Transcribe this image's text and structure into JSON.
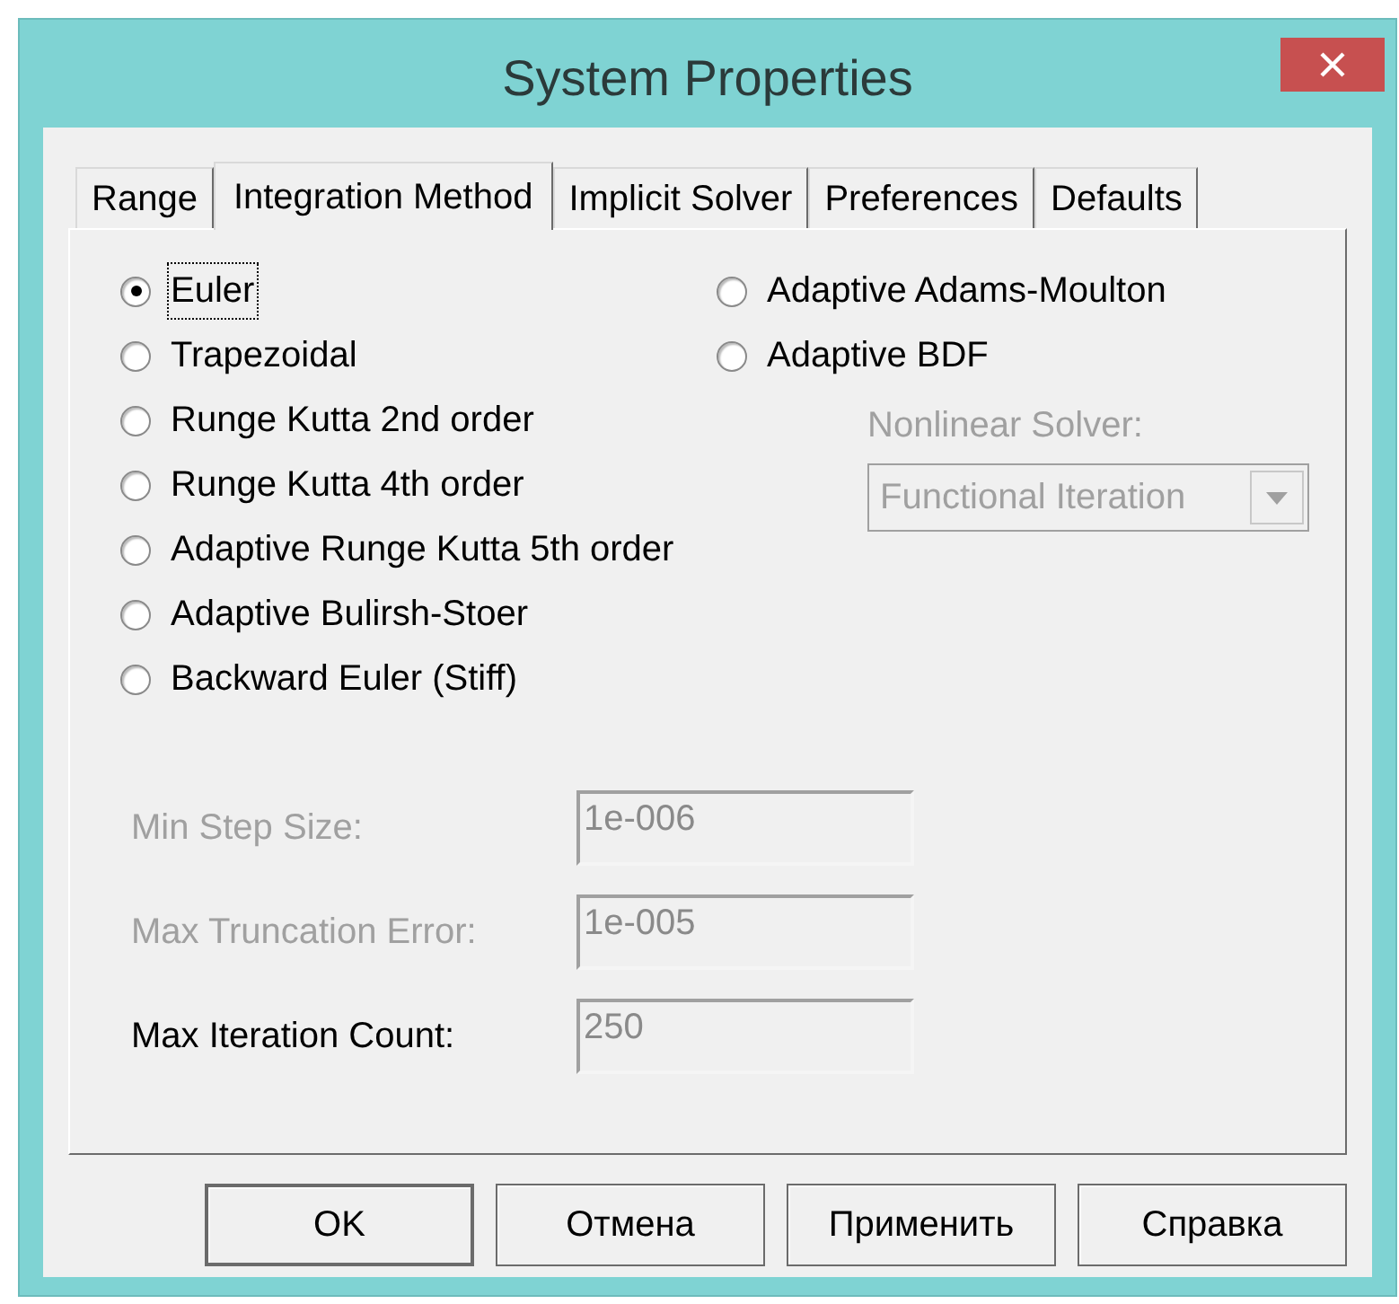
{
  "window": {
    "title": "System Properties"
  },
  "tabs": [
    {
      "label": "Range",
      "selected": false
    },
    {
      "label": "Integration Method",
      "selected": true
    },
    {
      "label": "Implicit Solver",
      "selected": false
    },
    {
      "label": "Preferences",
      "selected": false
    },
    {
      "label": "Defaults",
      "selected": false
    }
  ],
  "methods_left": [
    {
      "label": "Euler",
      "selected": true,
      "focused": true
    },
    {
      "label": "Trapezoidal",
      "selected": false,
      "focused": false
    },
    {
      "label": "Runge Kutta 2nd order",
      "selected": false,
      "focused": false
    },
    {
      "label": "Runge Kutta 4th order",
      "selected": false,
      "focused": false
    },
    {
      "label": "Adaptive Runge Kutta 5th order",
      "selected": false,
      "focused": false
    },
    {
      "label": "Adaptive Bulirsh-Stoer",
      "selected": false,
      "focused": false
    },
    {
      "label": "Backward Euler (Stiff)",
      "selected": false,
      "focused": false
    }
  ],
  "methods_right": [
    {
      "label": "Adaptive Adams-Moulton",
      "selected": false,
      "focused": false
    },
    {
      "label": "Adaptive BDF",
      "selected": false,
      "focused": false
    }
  ],
  "nonlinear_solver": {
    "label": "Nonlinear Solver:",
    "value": "Functional Iteration",
    "disabled": true
  },
  "fields": [
    {
      "label": "Min Step Size:",
      "value": "1e-006",
      "label_disabled": true
    },
    {
      "label": "Max Truncation Error:",
      "value": "1e-005",
      "label_disabled": true
    },
    {
      "label": "Max Iteration Count:",
      "value": "250",
      "label_disabled": false
    }
  ],
  "buttons": [
    "OK",
    "Отмена",
    "Применить",
    "Справка"
  ]
}
